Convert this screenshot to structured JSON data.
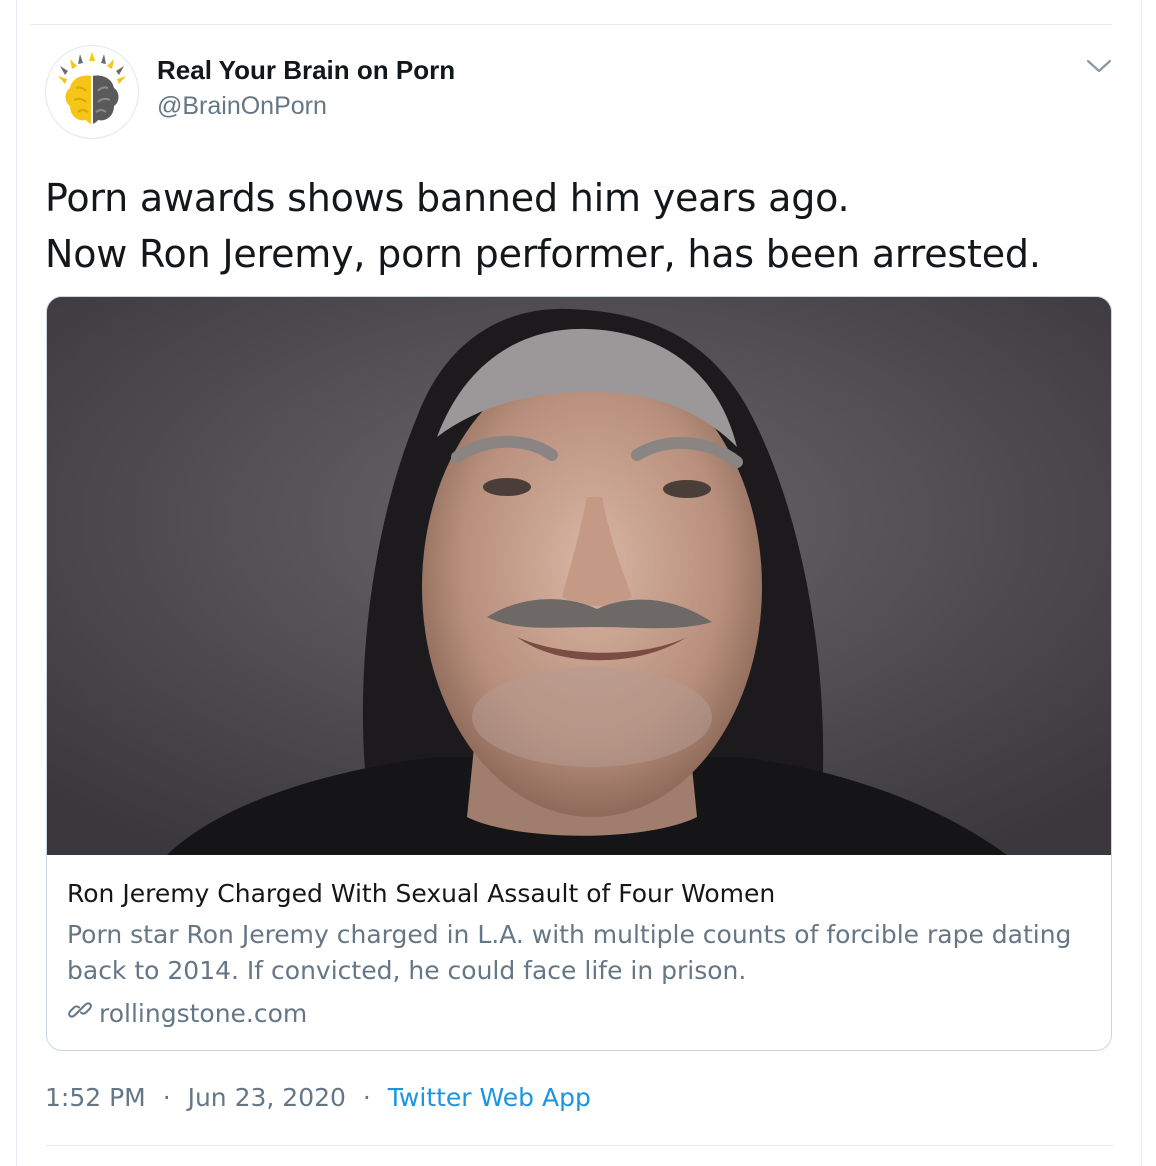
{
  "tweet": {
    "display_name": "Real Your Brain on Porn",
    "handle": "@BrainOnPorn",
    "text_lines": [
      "Porn awards shows banned him years ago.",
      "Now Ron Jeremy, porn performer, has been arrested."
    ],
    "time": "1:52 PM",
    "separator": "·",
    "date": "Jun 23, 2020",
    "source": "Twitter Web App"
  },
  "card": {
    "title": "Ron Jeremy Charged With Sexual Assault of Four Women",
    "description_lines": [
      "Porn star Ron Jeremy charged in L.A. with multiple counts of forcible rape dating",
      "back to 2014. If convicted, he could face life in prison."
    ],
    "domain": "rollingstone.com"
  },
  "icons": {
    "avatar": "brain-logo-icon",
    "caret": "chevron-down-icon",
    "link": "link-icon"
  },
  "colors": {
    "text_primary": "#14171a",
    "text_secondary": "#657786",
    "link": "#1b95e0",
    "border": "#ccd6dd",
    "logo_yellow": "#f5c518",
    "logo_gray": "#5a5a5a"
  }
}
